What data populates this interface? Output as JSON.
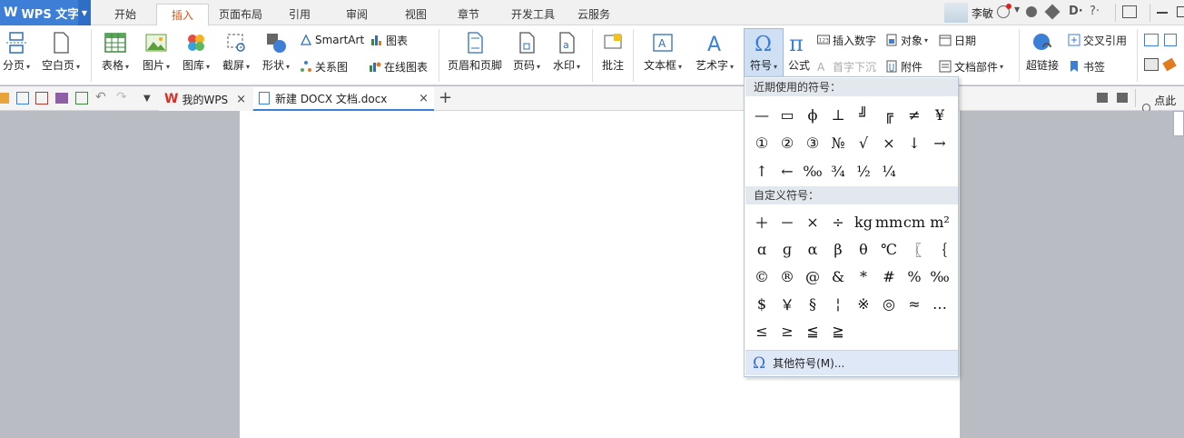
{
  "app": {
    "title": "WPS 文字"
  },
  "menu_tabs": [
    "开始",
    "插入",
    "页面布局",
    "引用",
    "审阅",
    "视图",
    "章节",
    "开发工具",
    "云服务"
  ],
  "active_tab": "插入",
  "user": {
    "name": "李敏"
  },
  "ribbon": {
    "page_break": "分页",
    "blank_page": "空白页",
    "table": "表格",
    "picture": "图片",
    "gallery": "图库",
    "screenshot": "截屏",
    "shape": "形状",
    "smartart": "SmartArt",
    "chart": "图表",
    "relation": "关系图",
    "online_chart": "在线图表",
    "header_footer": "页眉和页脚",
    "page_number": "页码",
    "watermark": "水印",
    "comment": "批注",
    "textbox": "文本框",
    "wordart": "艺术字",
    "symbol": "符号",
    "formula": "公式",
    "insert_number": "插入数字",
    "drop_cap": "首字下沉",
    "object": "对象",
    "attachment": "附件",
    "date": "日期",
    "doc_parts": "文档部件",
    "hyperlink": "超链接",
    "cross_ref": "交叉引用",
    "bookmark": "书签"
  },
  "doc_tabs": [
    {
      "label": "我的WPS"
    },
    {
      "label": "新建 DOCX 文档.docx"
    }
  ],
  "search_label": "点此查",
  "symbol_menu": {
    "recent_header": "近期使用的符号：",
    "recent": [
      "—",
      "▭",
      "ϕ",
      "⊥",
      "╝",
      "╔",
      "≠",
      "¥",
      "①",
      "②",
      "③",
      "№",
      "√",
      "×",
      "↓",
      "→",
      "↑",
      "←",
      "‰",
      "¾",
      "½",
      "¼"
    ],
    "custom_header": "自定义符号：",
    "custom": [
      "＋",
      "－",
      "×",
      "÷",
      "kg",
      "mm",
      "cm",
      "m²",
      "ɑ",
      "ɡ",
      "α",
      "β",
      "θ",
      "℃",
      "〖",
      "｛",
      "©",
      "®",
      "@",
      "&",
      "*",
      "#",
      "%",
      "‰",
      "$",
      "￥",
      "§",
      "¦",
      "※",
      "◎",
      "≈",
      "…",
      "≤",
      "≥",
      "≦",
      "≧"
    ],
    "more": "其他符号(M)..."
  }
}
